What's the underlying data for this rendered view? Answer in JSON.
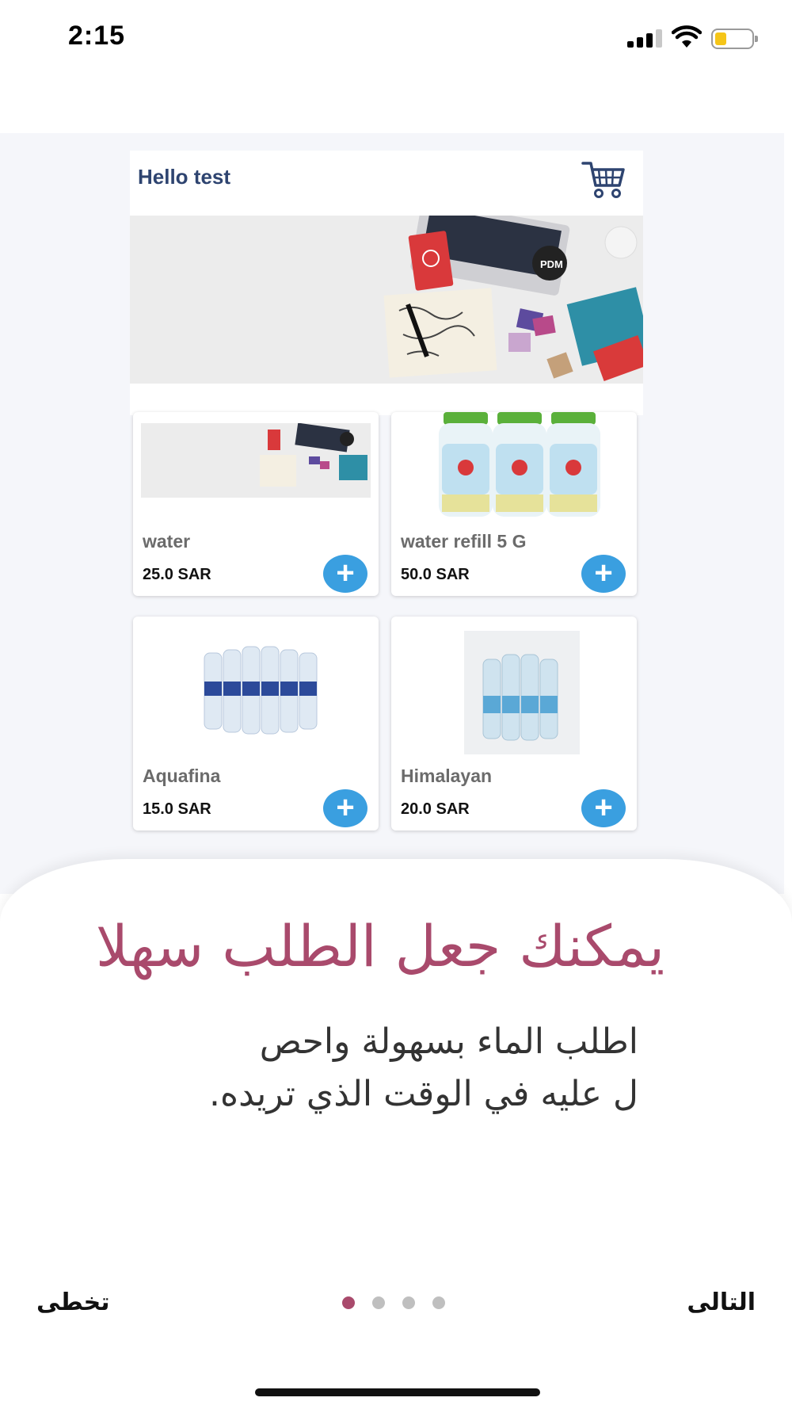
{
  "status_bar": {
    "time": "2:15",
    "battery_level": 0.3,
    "signal_bars": 3,
    "signal_icon": "signal-icon",
    "wifi_icon": "wifi-icon",
    "battery_icon": "battery-icon"
  },
  "preview": {
    "greeting": "Hello test",
    "cart_icon": "cart-icon",
    "products": [
      {
        "name": "water",
        "price": "25.0 SAR",
        "add_label": "+"
      },
      {
        "name": "water refill 5 G",
        "price": "50.0 SAR",
        "add_label": "+"
      },
      {
        "name": "Aquafina",
        "price": "15.0 SAR",
        "add_label": "+"
      },
      {
        "name": "Himalayan",
        "price": "20.0 SAR",
        "add_label": "+"
      }
    ]
  },
  "onboarding": {
    "title": "يمكنك جعل الطلب سهلا",
    "description_line1": "اطلب الماء بسهولة واحص",
    "description_line2": "ل عليه في الوقت الذي تريده.",
    "skip_label": "تخطى",
    "next_label": "التالى",
    "page_count": 4,
    "active_page": 1
  },
  "colors": {
    "accent": "#a94a6c",
    "add_button": "#3a9fe0",
    "header_text": "#2e4470",
    "inactive_dot": "#bfbfbf"
  }
}
